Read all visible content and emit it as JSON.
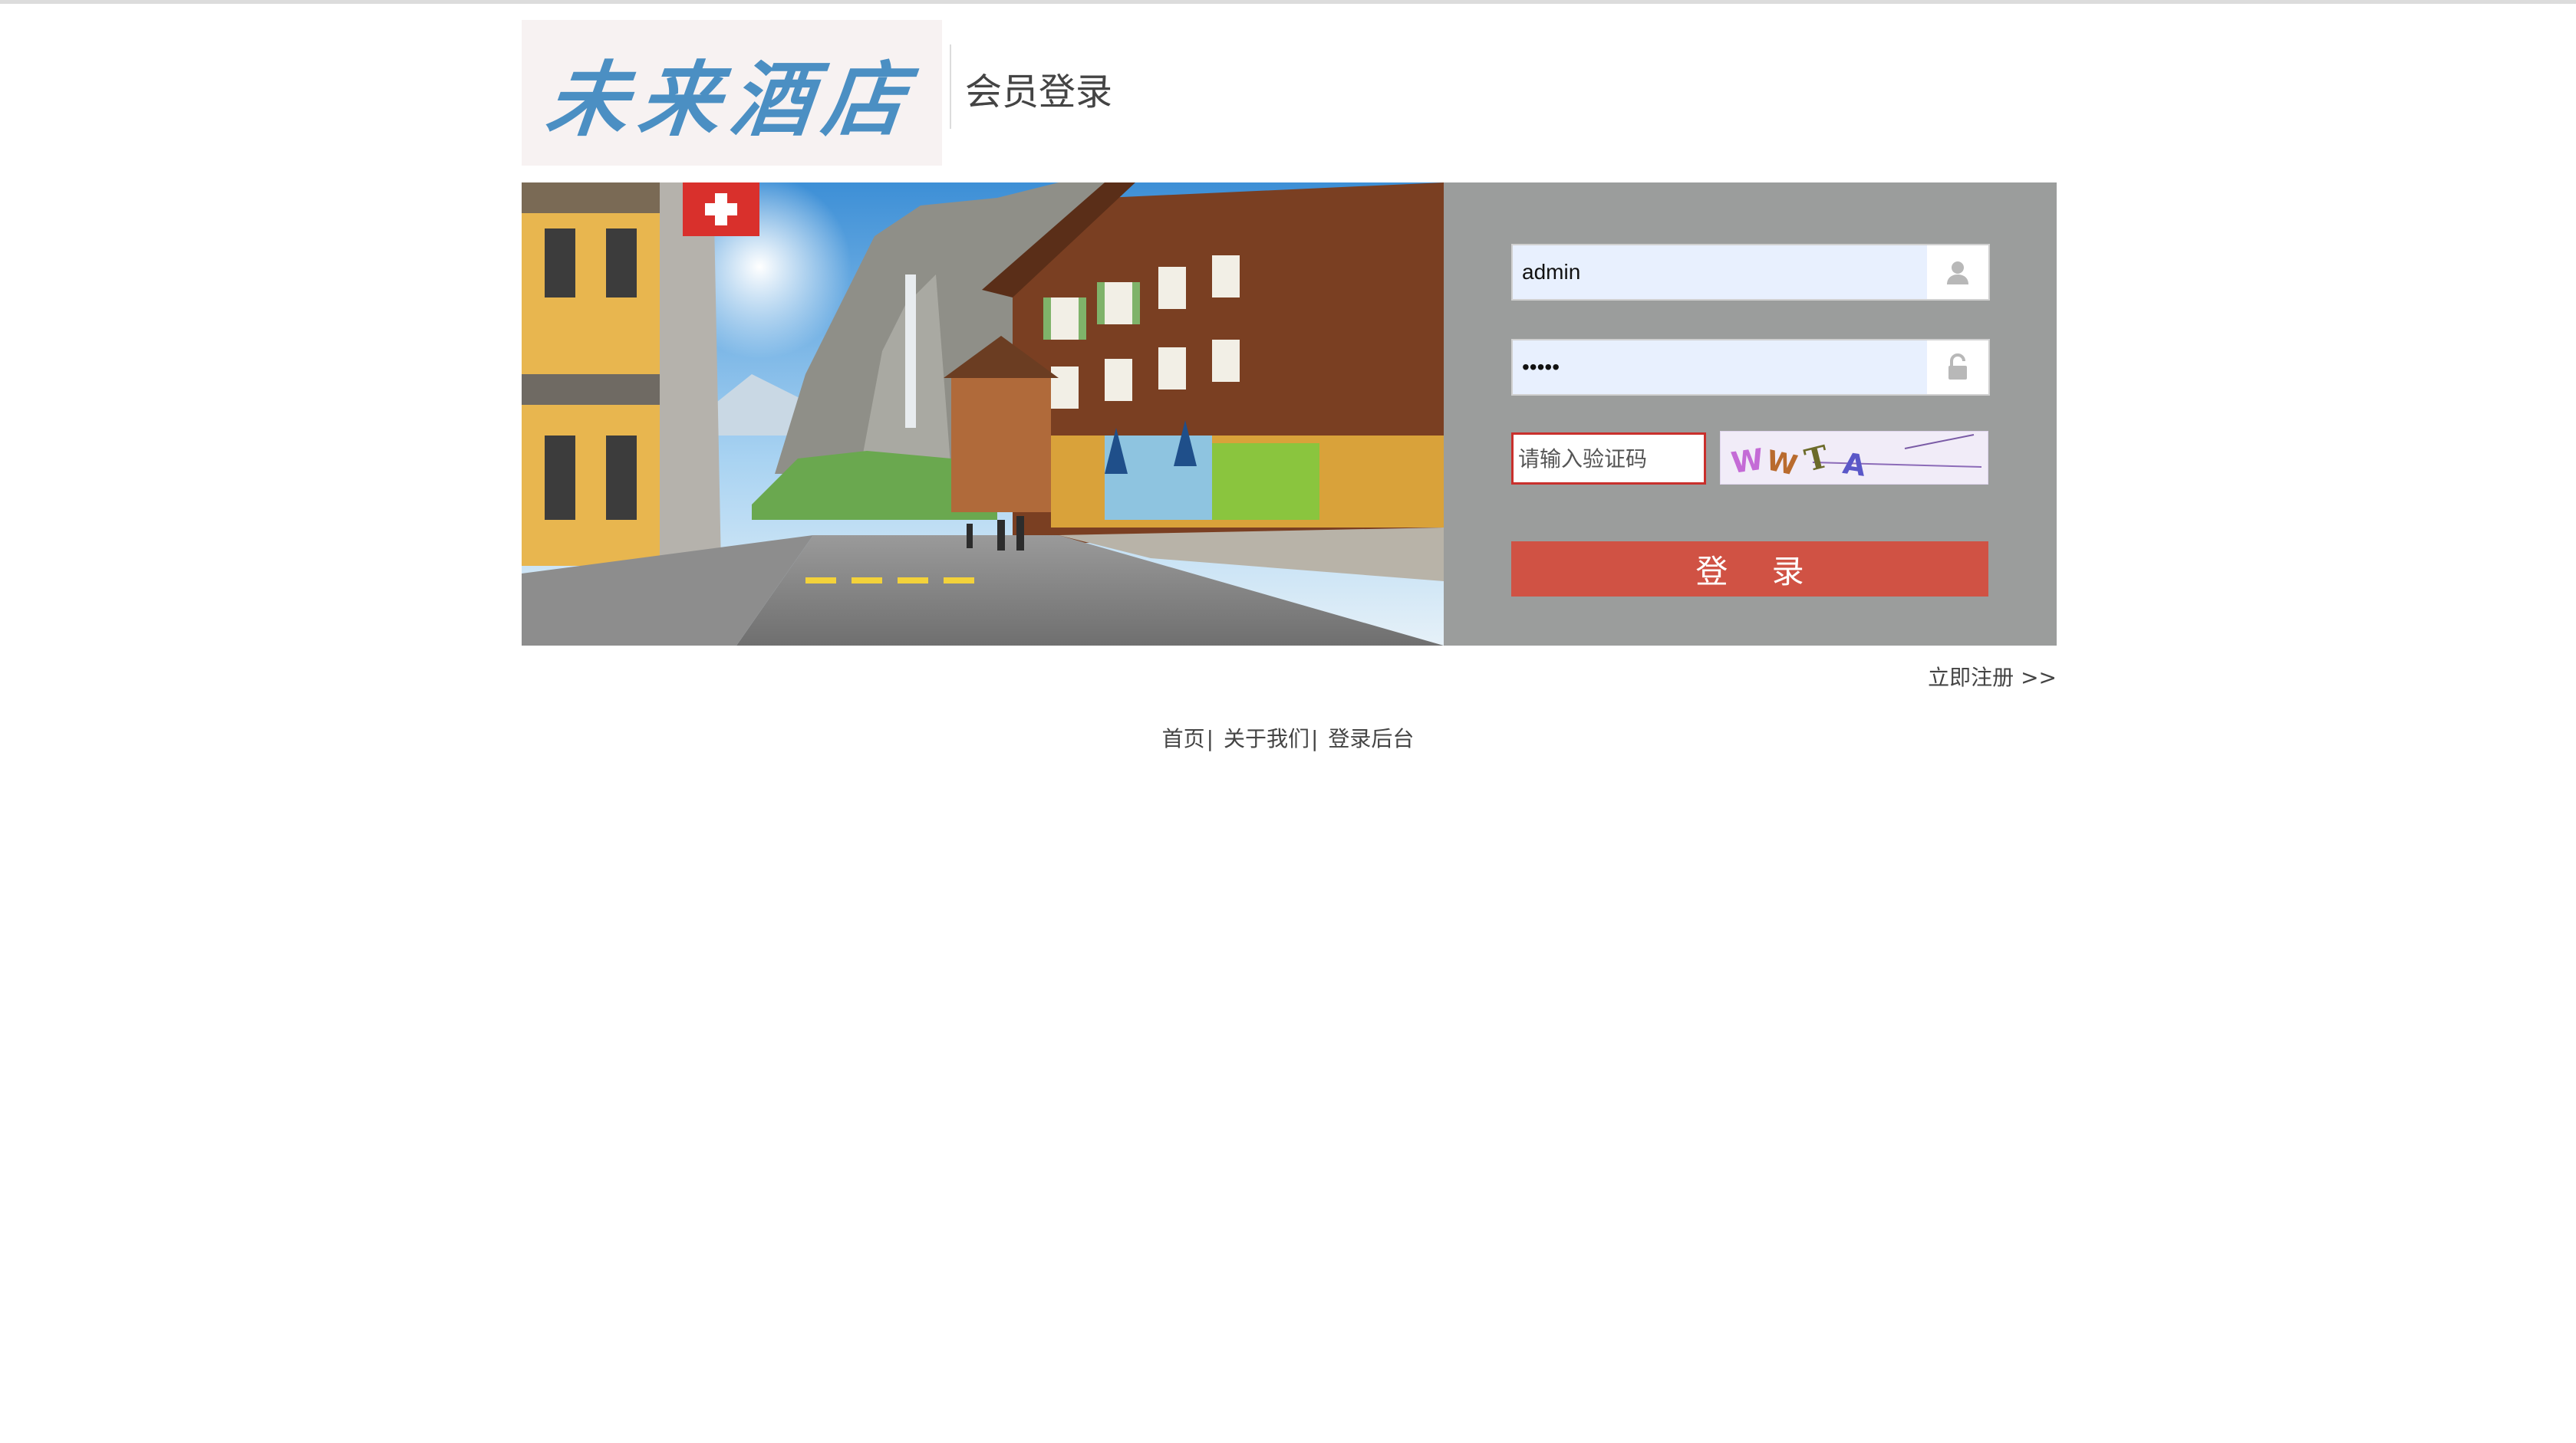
{
  "header": {
    "logo_text": "未来酒店",
    "title": "会员登录"
  },
  "login": {
    "username_value": "admin",
    "password_value": "•••••",
    "captcha_placeholder": "请输入验证码",
    "captcha_text": "WWTA",
    "submit_label": "登 录",
    "register_link": "立即注册 >>"
  },
  "footer": {
    "links": [
      "首页",
      "关于我们",
      "登录后台"
    ],
    "separator": "|"
  },
  "colors": {
    "accent_button": "#d05244",
    "panel_bg": "#9b9d9c",
    "logo_blue": "#4b8fc3",
    "captcha_border": "#c9302c"
  },
  "icons": {
    "username": "user-icon",
    "password": "lock-icon"
  }
}
